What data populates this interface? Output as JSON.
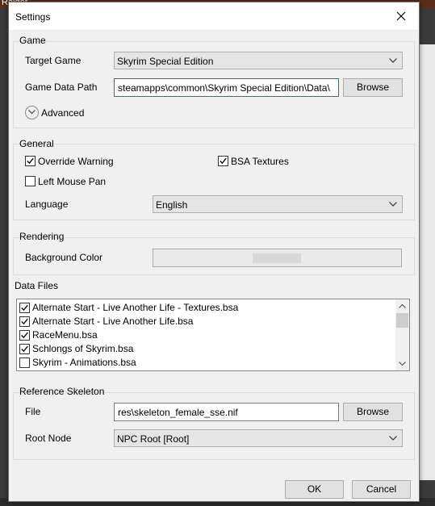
{
  "background": {
    "top_text": "Raider"
  },
  "dialog": {
    "title": "Settings"
  },
  "game": {
    "group_title": "Game",
    "target_game_label": "Target Game",
    "target_game_value": "Skyrim Special Edition",
    "data_path_label": "Game Data Path",
    "data_path_value": "steamapps\\common\\Skyrim Special Edition\\Data\\",
    "browse_label": "Browse",
    "advanced_label": "Advanced"
  },
  "general": {
    "group_title": "General",
    "override_warning_label": "Override Warning",
    "override_warning_checked": true,
    "bsa_textures_label": "BSA Textures",
    "bsa_textures_checked": true,
    "left_mouse_pan_label": "Left Mouse Pan",
    "left_mouse_pan_checked": false,
    "language_label": "Language",
    "language_value": "English"
  },
  "rendering": {
    "group_title": "Rendering",
    "background_color_label": "Background Color"
  },
  "data_files": {
    "group_title": "Data Files",
    "items": [
      {
        "label": "Alternate Start - Live Another Life - Textures.bsa",
        "checked": true
      },
      {
        "label": "Alternate Start - Live Another Life.bsa",
        "checked": true
      },
      {
        "label": "RaceMenu.bsa",
        "checked": true
      },
      {
        "label": "Schlongs of Skyrim.bsa",
        "checked": true
      },
      {
        "label": "Skyrim - Animations.bsa",
        "checked": false
      }
    ]
  },
  "skeleton": {
    "group_title": "Reference Skeleton",
    "file_label": "File",
    "file_value": "res\\skeleton_female_sse.nif",
    "browse_label": "Browse",
    "root_node_label": "Root Node",
    "root_node_value": "NPC Root [Root]"
  },
  "footer": {
    "ok_label": "OK",
    "cancel_label": "Cancel"
  }
}
